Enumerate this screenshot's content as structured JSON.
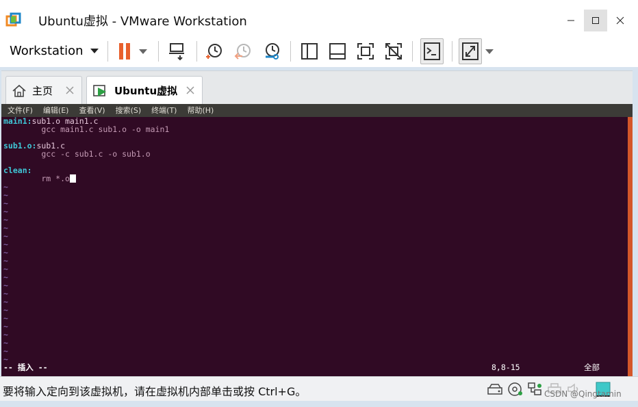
{
  "window": {
    "title": "Ubuntu虚拟 - VMware Workstation"
  },
  "toolbar": {
    "workstation_label": "Workstation",
    "icons": [
      "pause-icon",
      "send-ctrl-alt-del-icon",
      "snapshot-icon",
      "revert-snapshot-icon",
      "snapshot-manager-icon",
      "sidebar-icon",
      "console-view-icon",
      "fullscreen-icon",
      "unity-icon",
      "terminal-icon",
      "stretch-icon"
    ]
  },
  "tabs": [
    {
      "label": "主页",
      "icon": "home-icon"
    },
    {
      "label": "Ubuntu虚拟",
      "icon": "vm-running-icon"
    }
  ],
  "terminal": {
    "menu": [
      "文件(F)",
      "编辑(E)",
      "查看(V)",
      "搜索(S)",
      "终端(T)",
      "帮助(H)"
    ],
    "lines": [
      {
        "target": "main1:",
        "deps": "sub1.o main1.c"
      },
      {
        "cmd": "        gcc main1.c sub1.o -o main1"
      },
      {
        "blank": ""
      },
      {
        "target": "sub1.o:",
        "deps": "sub1.c"
      },
      {
        "cmd": "        gcc -c sub1.c -o sub1.o"
      },
      {
        "blank": ""
      },
      {
        "target": "clean:",
        "deps": ""
      },
      {
        "cmd": "        rm *.o"
      }
    ],
    "tilde": "~",
    "tilde_count": 22,
    "status_mode": "-- 插入 --",
    "status_position": "8,8-15",
    "status_scope": "全部"
  },
  "statusbar": {
    "message": "要将输入定向到该虚拟机，请在虚拟机内部单击或按 Ctrl+G。",
    "watermark": "CSDN @Qingtamin",
    "icons": [
      "hard-disk-icon",
      "cd-dvd-icon",
      "network-icon",
      "printer-icon",
      "sound-icon",
      "display-icon"
    ]
  },
  "colors": {
    "terminal_bg": "#300a24",
    "target": "#3fc8d8",
    "accent_orange": "#e8602c",
    "tilde": "#7a5a9a"
  }
}
